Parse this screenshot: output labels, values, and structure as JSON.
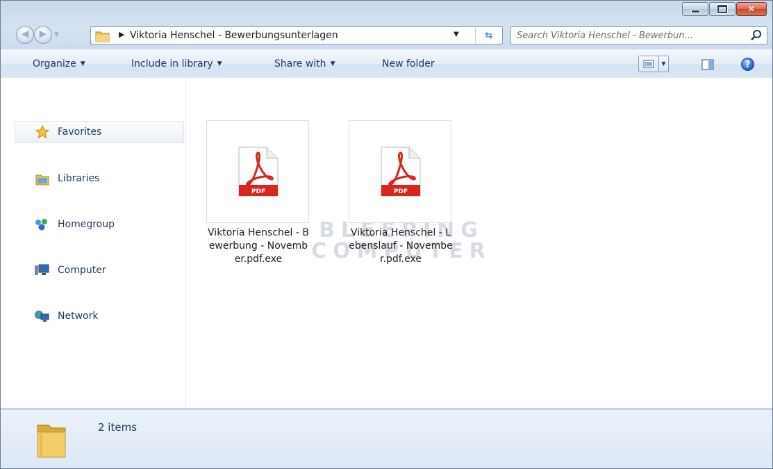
{
  "window": {
    "minimize_icon": "minimize-icon",
    "maximize_icon": "maximize-icon",
    "close_icon": "close-icon"
  },
  "navigation": {
    "back_icon": "back-arrow-icon",
    "forward_icon": "forward-arrow-icon",
    "address_path": "Viktoria Henschel - Bewerbungsunterlagen",
    "search_placeholder": "Search Viktoria Henschel - Bewerbun..."
  },
  "toolbar": {
    "organize_label": "Organize",
    "include_label": "Include in library",
    "share_label": "Share with",
    "new_folder_label": "New folder"
  },
  "sidebar": {
    "items": [
      {
        "label": "Favorites",
        "icon": "star-icon"
      },
      {
        "label": "Libraries",
        "icon": "libraries-icon"
      },
      {
        "label": "Homegroup",
        "icon": "homegroup-icon"
      },
      {
        "label": "Computer",
        "icon": "computer-icon"
      },
      {
        "label": "Network",
        "icon": "network-icon"
      }
    ]
  },
  "files": [
    {
      "name": "Viktoria Henschel - Bewerbung - November.pdf.exe",
      "icon": "pdf-icon"
    },
    {
      "name": "Viktoria Henschel - Lebenslauf - November.pdf.exe",
      "icon": "pdf-icon"
    }
  ],
  "watermark": {
    "line1": "BLEEPING",
    "line2": "COMPUTER"
  },
  "status": {
    "item_count": "2 items"
  },
  "colors": {
    "accent": "#1e395b",
    "pdf_red": "#d9261c"
  }
}
